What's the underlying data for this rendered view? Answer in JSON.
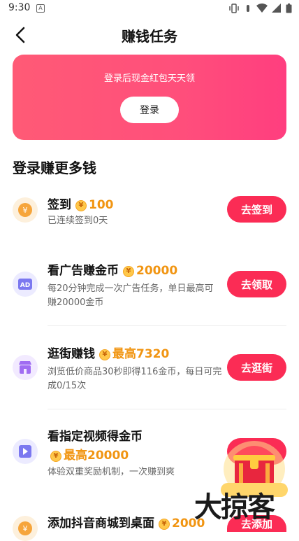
{
  "status_bar": {
    "time": "9:30"
  },
  "nav": {
    "title": "赚钱任务"
  },
  "banner": {
    "text": "登录后现金红包天天领",
    "login_label": "登录"
  },
  "section": {
    "title": "登录赚更多钱"
  },
  "tasks": [
    {
      "title": "签到",
      "reward": "100",
      "desc": "已连续签到0天",
      "action": "去签到",
      "icon": "yuan-coin-icon",
      "icon_bg": "#fdf0dc",
      "icon_color": "#f6a53b"
    },
    {
      "title": "看广告赚金币",
      "reward": "20000",
      "desc": "每20分钟完成一次广告任务，单日最高可赚20000金币",
      "action": "去领取",
      "icon": "ad-icon",
      "icon_bg": "#ecebff",
      "icon_color": "#7b78f0"
    },
    {
      "title": "逛街赚钱",
      "reward": "最高7320",
      "desc": "浏览低价商品30秒即得116金币，每日可完成0/15次",
      "action": "去逛街",
      "icon": "shop-icon",
      "icon_bg": "#f2eaff",
      "icon_color": "#a06cf2"
    },
    {
      "title": "看指定视频得金币",
      "reward": "最高20000",
      "desc": "体验双重奖励机制，一次赚到爽",
      "action": "",
      "icon": "video-icon",
      "icon_bg": "#ecebff",
      "icon_color": "#7b78f0"
    },
    {
      "title": "添加抖音商城到桌面",
      "reward": "2000",
      "desc": "",
      "action": "去添加",
      "icon": "yuan-coin-icon",
      "icon_bg": "#fdf0dc",
      "icon_color": "#f6a53b"
    }
  ],
  "watermark": {
    "text": "大掠客"
  },
  "colors": {
    "accent": "#fb2c55",
    "reward": "#f19512",
    "banner": "#ff4f7b"
  }
}
